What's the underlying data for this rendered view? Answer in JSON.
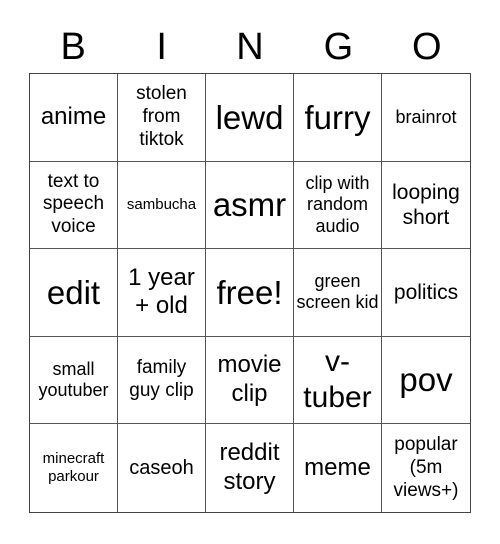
{
  "header": [
    "B",
    "I",
    "N",
    "G",
    "O"
  ],
  "cells": [
    "anime",
    "stolen from tiktok",
    "lewd",
    "furry",
    "brainrot",
    "text to speech voice",
    "sambucha",
    "asmr",
    "clip with random audio",
    "looping short",
    "edit",
    "1 year + old",
    "free!",
    "green screen kid",
    "politics",
    "small youtuber",
    "family guy clip",
    "movie clip",
    "v-tuber",
    "pov",
    "minecraft parkour",
    "caseoh",
    "reddit story",
    "meme",
    "popular (5m views+)"
  ]
}
